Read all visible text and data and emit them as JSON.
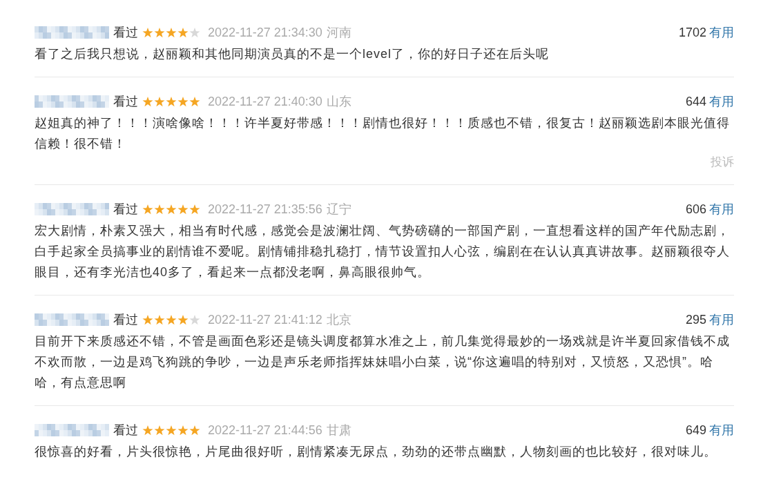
{
  "comments": [
    {
      "status": "看过",
      "stars": 4,
      "time": "2022-11-27 21:34:30",
      "region": "河南",
      "votes": "1702",
      "vote_label": "有用",
      "text": "看了之后我只想说，赵丽颖和其他同期演员真的不是一个level了，你的好日子还在后头呢"
    },
    {
      "status": "看过",
      "stars": 5,
      "time": "2022-11-27 21:40:30",
      "region": "山东",
      "votes": "644",
      "vote_label": "有用",
      "text": "赵姐真的神了！！！演啥像啥！！！许半夏好带感！！！剧情也很好！！！质感也不错，很复古！赵丽颖选剧本眼光值得信赖！很不错！",
      "report": "投诉"
    },
    {
      "status": "看过",
      "stars": 5,
      "time": "2022-11-27 21:35:56",
      "region": "辽宁",
      "votes": "606",
      "vote_label": "有用",
      "text": "宏大剧情，朴素又强大，相当有时代感，感觉会是波澜壮阔、气势磅礴的一部国产剧，一直想看这样的国产年代励志剧，白手起家全员搞事业的剧情谁不爱呢。剧情铺排稳扎稳打，情节设置扣人心弦，编剧在在认认真真讲故事。赵丽颖很夺人眼目，还有李光洁也40多了，看起来一点都没老啊，鼻高眼很帅气。"
    },
    {
      "status": "看过",
      "stars": 4,
      "time": "2022-11-27 21:41:12",
      "region": "北京",
      "votes": "295",
      "vote_label": "有用",
      "text": "目前开下来质感还不错，不管是画面色彩还是镜头调度都算水准之上，前几集觉得最妙的一场戏就是许半夏回家借钱不成不欢而散，一边是鸡飞狗跳的争吵，一边是声乐老师指挥妹妹唱小白菜，说“你这遍唱的特别对，又愤怒，又恐惧”。哈哈，有点意思啊"
    },
    {
      "status": "看过",
      "stars": 5,
      "time": "2022-11-27 21:44:56",
      "region": "甘肃",
      "votes": "649",
      "vote_label": "有用",
      "text": "很惊喜的好看，片头很惊艳，片尾曲很好听，剧情紧凑无尿点，劲劲的还带点幽默，人物刻画的也比较好，很对味儿。"
    }
  ]
}
